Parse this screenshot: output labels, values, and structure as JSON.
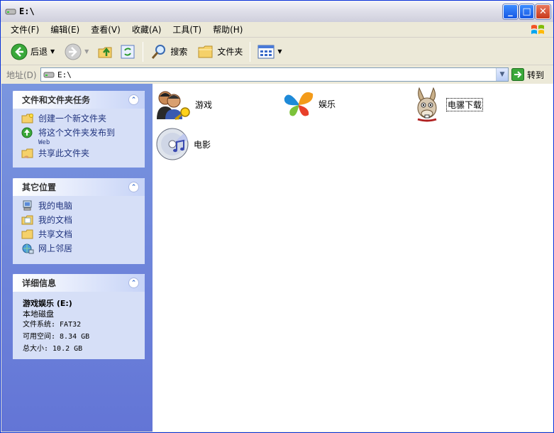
{
  "window": {
    "title": "E:\\"
  },
  "menu": [
    "文件(F)",
    "编辑(E)",
    "查看(V)",
    "收藏(A)",
    "工具(T)",
    "帮助(H)"
  ],
  "toolbar": {
    "back": "后退",
    "search": "搜索",
    "folders": "文件夹"
  },
  "address": {
    "label": "地址(D)",
    "value": "E:\\",
    "go": "转到"
  },
  "tasks_panel": {
    "title": "文件和文件夹任务",
    "items": [
      {
        "label": "创建一个新文件夹",
        "sub": ""
      },
      {
        "label": "将这个文件夹发布到",
        "sub": "Web"
      },
      {
        "label": "共享此文件夹",
        "sub": ""
      }
    ]
  },
  "places_panel": {
    "title": "其它位置",
    "items": [
      "我的电脑",
      "我的文档",
      "共享文档",
      "网上邻居"
    ]
  },
  "details_panel": {
    "title": "详细信息",
    "name": "游戏娱乐 (E:)",
    "type": "本地磁盘",
    "fs": "文件系统: FAT32",
    "free": "可用空间: 8.34 GB",
    "total": "总大小: 10.2 GB"
  },
  "folders": [
    {
      "label": "游戏"
    },
    {
      "label": "娱乐"
    },
    {
      "label": "电骡下载"
    },
    {
      "label": "电影"
    }
  ],
  "colors": {
    "accent": "#215dc6",
    "pane": "#6f87da"
  }
}
